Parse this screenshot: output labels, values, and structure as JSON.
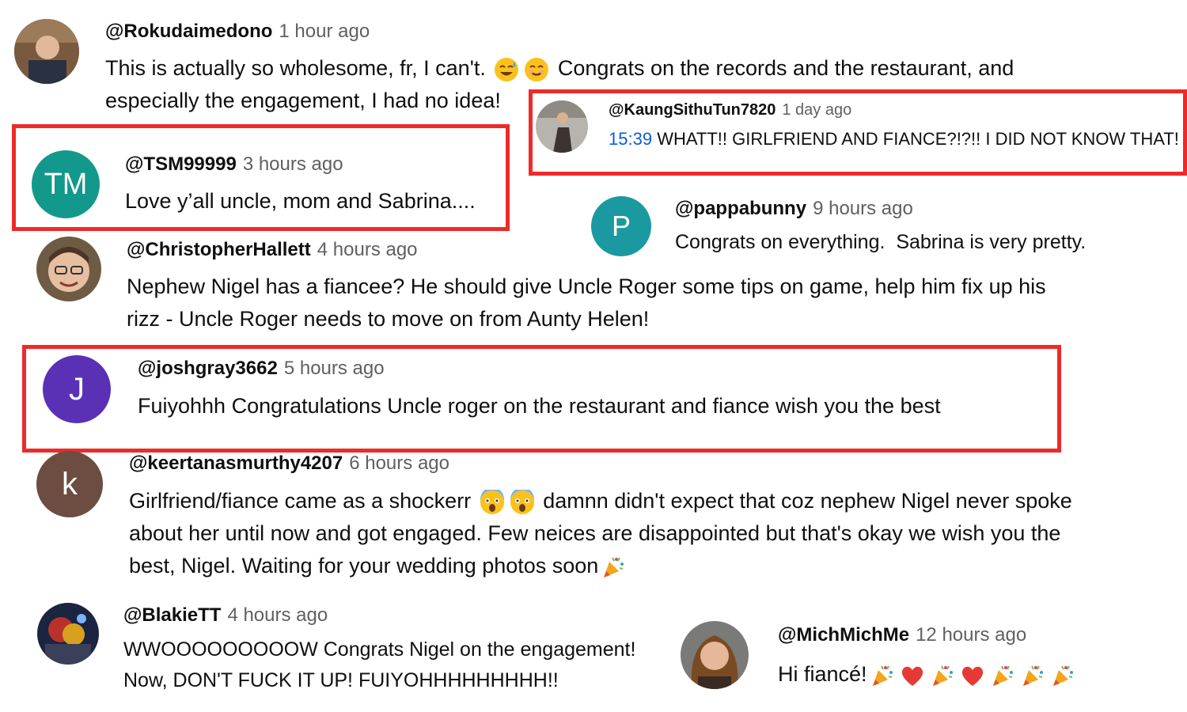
{
  "comments": [
    {
      "handle": "@Rokudaimedono",
      "time": "1 hour ago",
      "line1a": "This is actually so wholesome, fr, I can't.",
      "line1b": "Congrats on the records and the restaurant, and",
      "line2": "especially the engagement, I had no idea!",
      "avatar_kind": "photo"
    },
    {
      "handle": "@KaungSithuTun7820",
      "time": "1 day ago",
      "timestamp_link": "15:39",
      "text": "WHATT!! GIRLFRIEND AND FIANCE?!?!! I DID NOT KNOW THAT!",
      "avatar_kind": "photo"
    },
    {
      "handle": "@TSM99999",
      "time": "3 hours ago",
      "text": "Love y’all uncle, mom and Sabrina....",
      "avatar_letter": "TM",
      "avatar_color": "#12998b"
    },
    {
      "handle": "@pappabunny",
      "time": "9 hours ago",
      "text": "Congrats on everything.  Sabrina is very pretty.",
      "avatar_letter": "P",
      "avatar_color": "#1a9aa0"
    },
    {
      "handle": "@ChristopherHallett",
      "time": "4 hours ago",
      "line1": "Nephew Nigel has a fiancee? He should give Uncle Roger some tips on game, help him fix up his",
      "line2": "rizz - Uncle Roger needs to move on from Aunty Helen!",
      "avatar_kind": "photo"
    },
    {
      "handle": "@joshgray3662",
      "time": "5 hours ago",
      "text": "Fuiyohhh Congratulations Uncle roger on the restaurant and fiance wish you the best",
      "avatar_letter": "J",
      "avatar_color": "#5a31b4"
    },
    {
      "handle": "@keertanasmurthy4207",
      "time": "6 hours ago",
      "line1a": "Girlfriend/fiance came as a shockerr",
      "line1b": "damnn didn't expect that coz nephew Nigel never spoke",
      "line2": "about her until now and got engaged. Few neices are disappointed but that's okay we wish you the",
      "line3": "best, Nigel. Waiting for your wedding photos soon",
      "avatar_letter": "k",
      "avatar_color": "#6d4c41"
    },
    {
      "handle": "@BlakieTT",
      "time": "4 hours ago",
      "line1": "WWOOOOOOOOOW Congrats Nigel on the engagement!",
      "line2": "Now, DON'T FUCK IT UP! FUIYOHHHHHHHHH!!",
      "avatar_kind": "photo"
    },
    {
      "handle": "@MichMichMe",
      "time": "12 hours ago",
      "text": "Hi fiancé!",
      "avatar_kind": "photo"
    }
  ],
  "colors": {
    "highlight_box": "#ee2a2a",
    "link": "#065fd4",
    "meta": "#606060"
  },
  "icons": [
    "sweat-smile-emoji",
    "smile-emoji",
    "scream-emoji",
    "party-popper-emoji",
    "red-heart-emoji"
  ]
}
